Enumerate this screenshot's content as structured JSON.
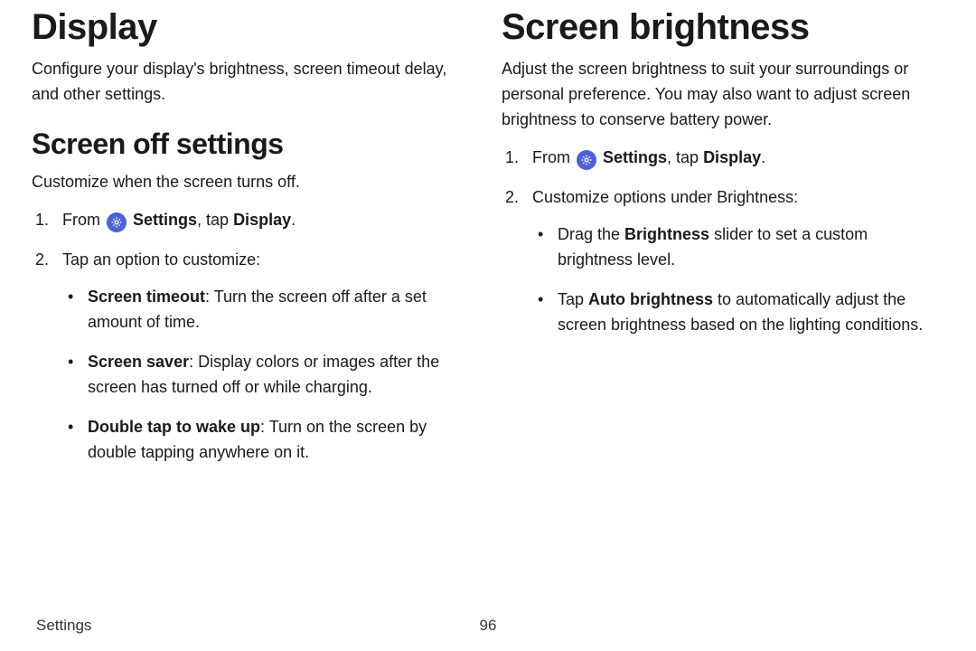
{
  "left": {
    "h1": "Display",
    "intro": "Configure your display's brightness, screen timeout delay, and other settings.",
    "h2": "Screen off settings",
    "sub": "Customize when the screen turns off.",
    "step1_pre": "From ",
    "step1_settings": "Settings",
    "step1_mid": ", tap ",
    "step1_display": "Display",
    "step1_post": ".",
    "step2": "Tap an option to customize:",
    "b1_label": "Screen timeout",
    "b1_rest": ": Turn the screen off after a set amount of time.",
    "b2_label": "Screen saver",
    "b2_rest": ": Display colors or images after the screen has turned off or while charging.",
    "b3_label": "Double tap to wake up",
    "b3_rest": ": Turn on the screen by double tapping anywhere on it."
  },
  "right": {
    "h1": "Screen brightness",
    "intro": "Adjust the screen brightness to suit your surroundings or personal preference. You may also want to adjust screen brightness to conserve battery power.",
    "step1_pre": "From ",
    "step1_settings": "Settings",
    "step1_mid": ", tap ",
    "step1_display": "Display",
    "step1_post": ".",
    "step2": "Customize options under Brightness:",
    "b1_pre": "Drag the ",
    "b1_label": "Brightness",
    "b1_rest": " slider to set a custom brightness level.",
    "b2_pre": "Tap ",
    "b2_label": "Auto brightness",
    "b2_rest": " to automatically adjust the screen brightness based on the lighting conditions."
  },
  "footer": {
    "section": "Settings",
    "page": "96"
  }
}
